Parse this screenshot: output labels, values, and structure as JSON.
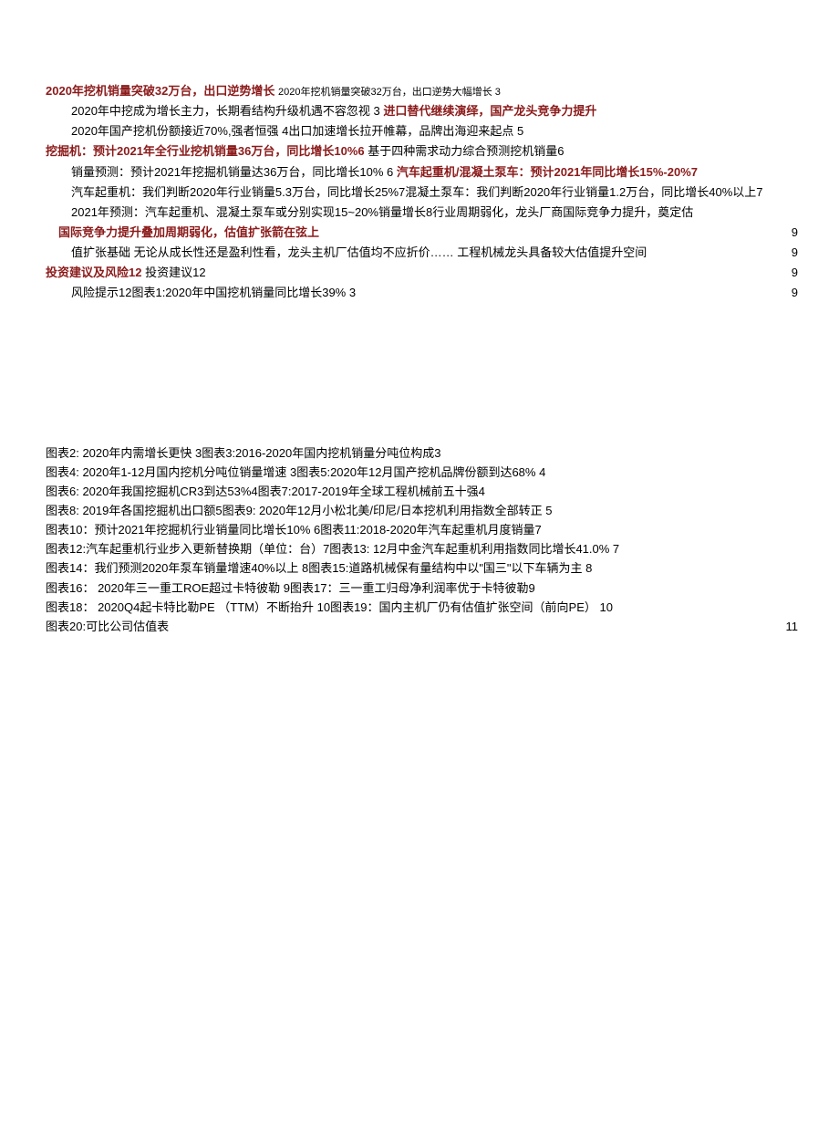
{
  "top": {
    "line1_red": "2020年挖机销量突破32万台，出口逆势增长",
    "line1_small": "2020年挖机销量突破32万台，出口逆势大幅增长 3",
    "line2": "2020年中挖成为增长主力，长期看结构升级机遇不容忽视  3",
    "line2_red": "进口替代继续演绎，国产龙头竞争力提升",
    "line3": "2020年国产挖机份额接近70%,强者恒强  4出口加速增长拉开帷幕，品牌出海迎来起点  5",
    "line4_red": "挖掘机：预计2021年全行业挖机销量36万台，同比增长10%6",
    "line4_tail": "基于四种需求动力综合预测挖机销量6",
    "line5": "销量预测：预计2021年挖掘机销量达36万台，同比增长10% 6",
    "line5_red": "汽车起重机/混凝土泵车：预计2021年同比增长15%-20%7",
    "line6": "汽车起重机：我们判断2020年行业销量5.3万台，同比增长25%7混凝土泵车：我们判断2020年行业销量1.2万台，同比增长40%以上7",
    "line7": "2021年预测：汽车起重机、混凝土泵车或分别实现15~20%销量增长8行业周期弱化，龙头厂商国际竞争力提升，奠定估",
    "line8_red": "国际竞争力提升叠加周期弱化，估值扩张箭在弦上",
    "line8_num": "9",
    "line9": "值扩张基础  无论从成长性还是盈利性看，龙头主机厂估值均不应折价……  工程机械龙头具备较大估值提升空间",
    "line9_num": "9",
    "line10_red": "投资建议及风险12",
    "line10_tail": "投资建议12",
    "line10_num": "9",
    "line11": "风险提示12图表1:2020年中国挖机销量同比增长39% 3",
    "line11_num": "9"
  },
  "charts": {
    "c2": "图表2: 2020年内需增长更快  3图表3:2016-2020年国内挖机销量分吨位构成3",
    "c4": "图表4: 2020年1-12月国内挖机分吨位销量增速  3图表5:2020年12月国产挖机品牌份额到达68% 4",
    "c6": "图表6: 2020年我国挖掘机CR3到达53%4图表7:2017-2019年全球工程机械前五十强4",
    "c8": "图表8: 2019年各国挖掘机出口额5图表9: 2020年12月小松北美/印尼/日本挖机利用指数全部转正  5",
    "c10": "图表10：预计2021年挖掘机行业销量同比增长10% 6图表11:2018-2020年汽车起重机月度销量7",
    "c12": "图表12:汽车起重机行业步入更新替换期（单位：台）7图表13: 12月中金汽车起重机利用指数同比增长41.0% 7",
    "c14": "图表14：我们预测2020年泵车销量增速40%以上  8图表15:道路机械保有量结构中以\"国三\"以下车辆为主  8",
    "c16": "图表16： 2020年三一重工ROE超过卡特彼勒  9图表17：三一重工归母净利润率优于卡特彼勒9",
    "c18": "图表18： 2020Q4起卡特比勒PE （TTM）不断抬升  10图表19：国内主机厂仍有估值扩张空间（前向PE） 10",
    "c20": "图表20:可比公司估值表",
    "c20_num": "11"
  }
}
